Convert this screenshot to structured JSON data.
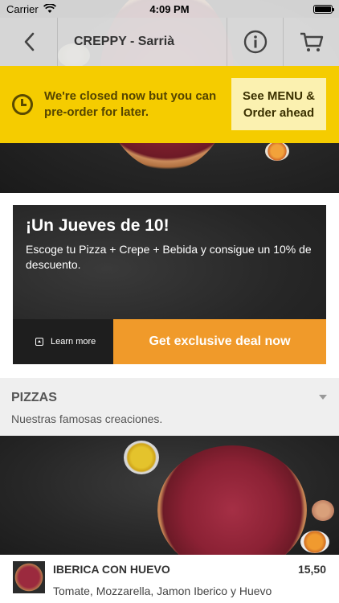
{
  "status_bar": {
    "carrier": "Carrier",
    "time": "4:09 PM"
  },
  "nav": {
    "title": "CREPPY - Sarrià"
  },
  "closed_banner": {
    "message": "We're closed now but you can pre-order for later.",
    "cta": "See MENU & Order ahead"
  },
  "promo": {
    "title": "¡Un Jueves de 10!",
    "description": "Escoge tu Pizza + Crepe + Bebida y consigue un 10% de descuento.",
    "learn_more": "Learn more",
    "deal_button": "Get exclusive deal now"
  },
  "category": {
    "name": "PIZZAS",
    "description": "Nuestras famosas creaciones."
  },
  "product": {
    "name": "IBERICA CON HUEVO",
    "price": "15,50",
    "ingredients": "Tomate, Mozzarella, Jamon Iberico y Huevo"
  },
  "colors": {
    "banner": "#f5cc00",
    "deal_button": "#f09a2a",
    "category_bg": "#efefef"
  },
  "icons": [
    "wifi-icon",
    "battery-icon",
    "back-chevron-icon",
    "info-icon",
    "cart-icon",
    "clock-icon",
    "learn-more-icon",
    "chevron-down-icon"
  ]
}
